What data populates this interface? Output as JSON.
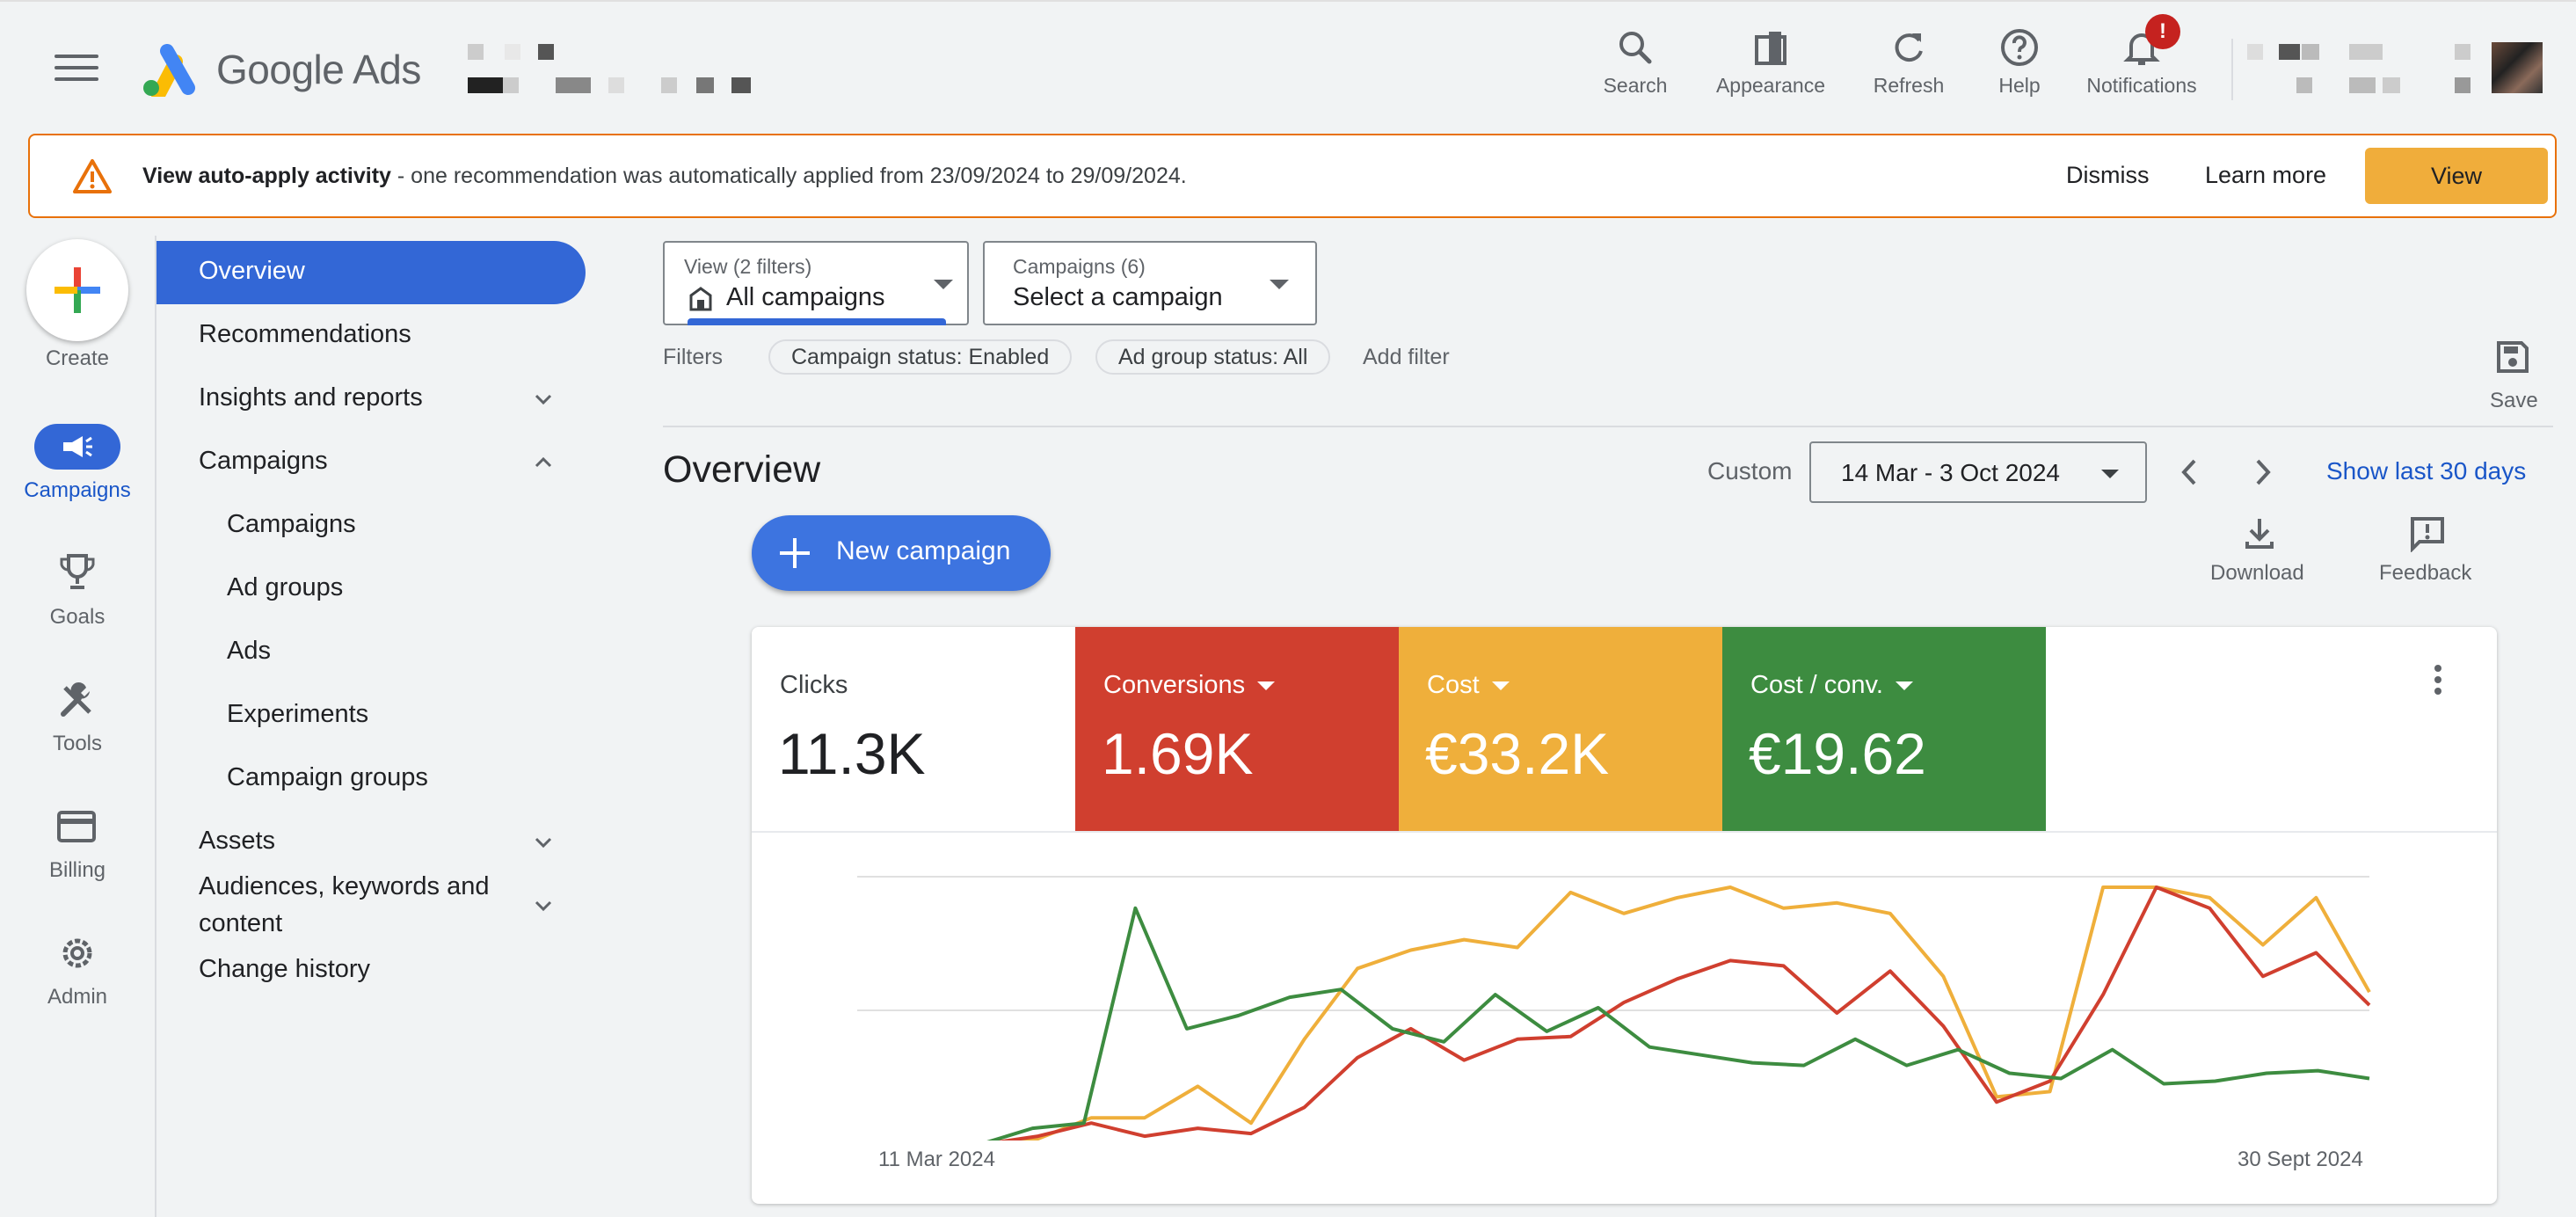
{
  "header": {
    "brand": "Google Ads",
    "actions": [
      {
        "label": "Search",
        "icon": "search-icon"
      },
      {
        "label": "Appearance",
        "icon": "appearance-icon"
      },
      {
        "label": "Refresh",
        "icon": "refresh-icon"
      },
      {
        "label": "Help",
        "icon": "help-icon"
      },
      {
        "label": "Notifications",
        "icon": "bell-icon"
      }
    ],
    "notification_badge": "!"
  },
  "banner": {
    "bold": "View auto-apply activity",
    "text": " - one recommendation was automatically applied from 23/09/2024 to 29/09/2024.",
    "dismiss": "Dismiss",
    "learn_more": "Learn more",
    "view": "View"
  },
  "rail": {
    "create": "Create",
    "campaigns": "Campaigns",
    "goals": "Goals",
    "tools": "Tools",
    "billing": "Billing",
    "admin": "Admin"
  },
  "nav": {
    "overview": "Overview",
    "recommendations": "Recommendations",
    "insights": "Insights and reports",
    "campaigns": "Campaigns",
    "sub": [
      "Campaigns",
      "Ad groups",
      "Ads",
      "Experiments",
      "Campaign groups"
    ],
    "assets": "Assets",
    "audiences_1": "Audiences, keywords and",
    "audiences_2": "content",
    "change_history": "Change history"
  },
  "filters": {
    "view_small": "View (2 filters)",
    "view_value": "All campaigns",
    "campaigns_small": "Campaigns (6)",
    "campaigns_value": "Select a campaign",
    "label": "Filters",
    "chip1": "Campaign status: Enabled",
    "chip2": "Ad group status: All",
    "add_filter": "Add filter",
    "save": "Save"
  },
  "overview": {
    "title": "Overview",
    "custom": "Custom",
    "date_range": "14 Mar - 3 Oct 2024",
    "show_last": "Show last 30 days",
    "new_campaign": "New campaign",
    "download": "Download",
    "feedback": "Feedback"
  },
  "metrics": [
    {
      "label": "Clicks",
      "value": "11.3K",
      "color": "#ffffff"
    },
    {
      "label": "Conversions",
      "value": "1.69K",
      "color": "#d03f2f"
    },
    {
      "label": "Cost",
      "value": "€33.2K",
      "color": "#efaf3b"
    },
    {
      "label": "Cost / conv.",
      "value": "€19.62",
      "color": "#3d8c40"
    }
  ],
  "chart_data": {
    "type": "line",
    "x_start_label": "11 Mar 2024",
    "x_end_label": "30 Sept 2024",
    "series": [
      {
        "metric": "Cost",
        "color": "#efaf3b",
        "values": [
          0,
          0,
          0,
          0.02,
          0.1,
          0.1,
          0.22,
          0.08,
          0.4,
          0.67,
          0.74,
          0.78,
          0.75,
          0.96,
          0.88,
          0.94,
          0.98,
          0.9,
          0.92,
          0.88,
          0.64,
          0.18,
          0.2,
          0.98,
          0.98,
          0.94,
          0.76,
          0.94,
          0.58
        ]
      },
      {
        "metric": "Conversions",
        "color": "#d03f2f",
        "values": [
          0,
          0,
          0,
          0.03,
          0.08,
          0.03,
          0.06,
          0.04,
          0.14,
          0.33,
          0.44,
          0.32,
          0.4,
          0.41,
          0.54,
          0.63,
          0.7,
          0.68,
          0.5,
          0.66,
          0.45,
          0.16,
          0.24,
          0.57,
          0.98,
          0.9,
          0.64,
          0.73,
          0.53
        ]
      },
      {
        "metric": "Cost / conv.",
        "color": "#3d8c40",
        "values": [
          0,
          0,
          0,
          0.06,
          0.08,
          0.9,
          0.44,
          0.49,
          0.56,
          0.59,
          0.44,
          0.39,
          0.57,
          0.43,
          0.52,
          0.37,
          0.34,
          0.31,
          0.3,
          0.4,
          0.3,
          0.36,
          0.27,
          0.25,
          0.36,
          0.23,
          0.24,
          0.27,
          0.28,
          0.25
        ]
      }
    ]
  }
}
